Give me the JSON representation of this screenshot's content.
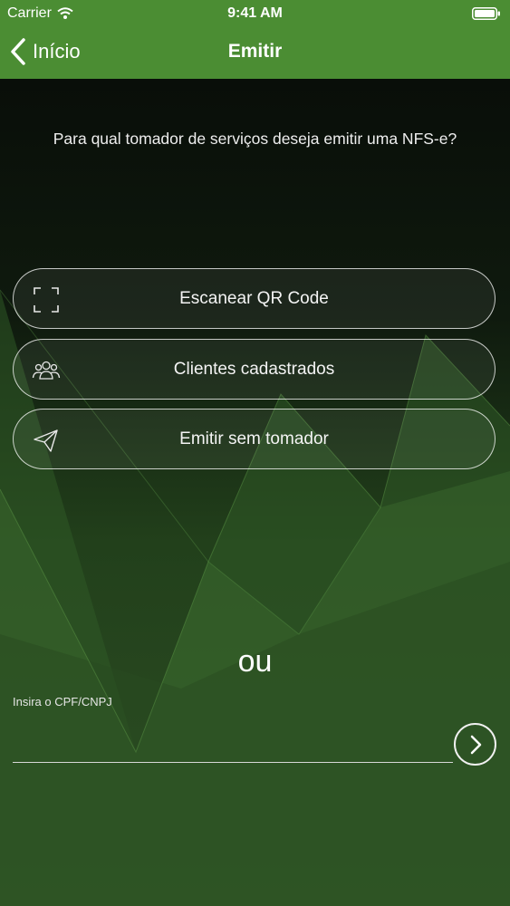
{
  "status_bar": {
    "carrier": "Carrier",
    "time": "9:41 AM"
  },
  "nav": {
    "back_label": "Início",
    "title": "Emitir"
  },
  "prompt": "Para qual tomador de serviços deseja emitir uma NFS-e?",
  "options": [
    {
      "label": "Escanear QR Code",
      "icon": "qr-scan-icon"
    },
    {
      "label": "Clientes cadastrados",
      "icon": "people-icon"
    },
    {
      "label": "Emitir sem tomador",
      "icon": "paper-plane-icon"
    }
  ],
  "separator": "ou",
  "cpf": {
    "label": "Insira o CPF/CNPJ",
    "value": "",
    "placeholder": ""
  },
  "colors": {
    "brand": "#4b8d33",
    "background": "#0c120c"
  }
}
